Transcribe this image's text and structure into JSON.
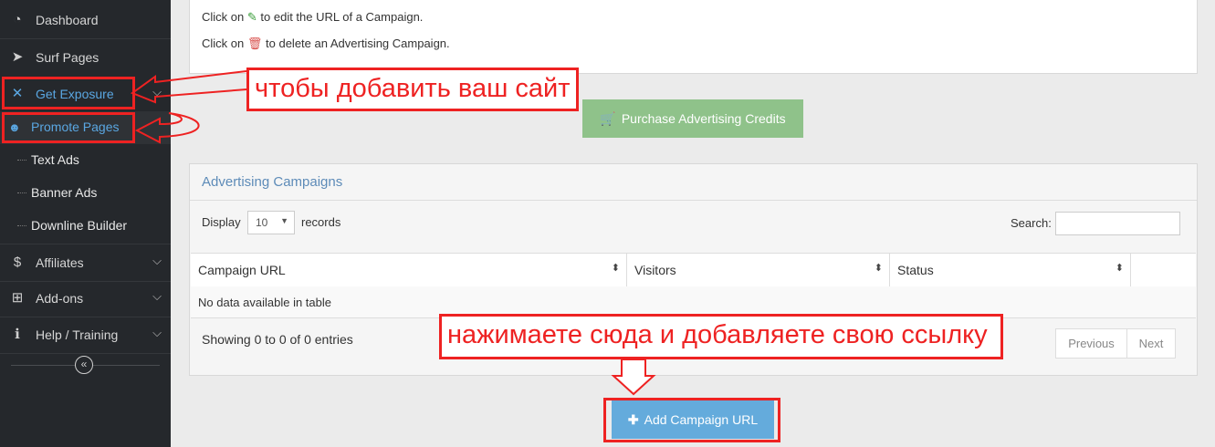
{
  "sidebar": {
    "items": [
      {
        "label": "Dashboard",
        "icon": "dashboard-icon"
      },
      {
        "label": "Surf Pages",
        "icon": "paper-plane-icon"
      },
      {
        "label": "Get Exposure",
        "icon": "expand-arrows-icon"
      },
      {
        "label": "Affiliates",
        "icon": "dollar-icon"
      },
      {
        "label": "Add-ons",
        "icon": "plus-square-icon"
      },
      {
        "label": "Help / Training",
        "icon": "info-icon"
      }
    ],
    "subitems": [
      {
        "label": "Promote Pages",
        "icon": "users-icon"
      },
      {
        "label": "Text Ads"
      },
      {
        "label": "Banner Ads"
      },
      {
        "label": "Downline Builder"
      }
    ]
  },
  "info": {
    "line1_pre": "Click on",
    "line1_post": "to edit the URL of a Campaign.",
    "line2_pre": "Click on",
    "line2_post": "to delete an Advertising Campaign."
  },
  "purchase_button": "Purchase Advertising Credits",
  "campaigns": {
    "title": "Advertising Campaigns",
    "display_label": "Display",
    "records_value": "10",
    "records_label": "records",
    "search_label": "Search:",
    "columns": [
      "Campaign URL",
      "Visitors",
      "Status"
    ],
    "empty_text": "No data available in table",
    "showing_text": "Showing 0 to 0 of 0 entries",
    "pager": {
      "previous": "Previous",
      "next": "Next"
    }
  },
  "add_button": "Add Campaign URL",
  "annotations": {
    "add_site": "чтобы добавить ваш сайт",
    "click_here": "нажимаете сюда и добавляете свою ссылку",
    "color": "#e22222"
  },
  "colors": {
    "sidebar_bg": "#25282c",
    "active_blue": "#5aa7e2",
    "purchase_green": "#8fc28a",
    "add_blue": "#64abdc"
  }
}
